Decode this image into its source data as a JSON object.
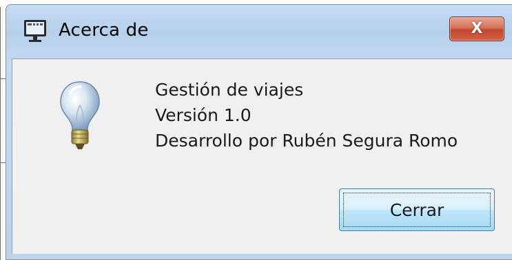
{
  "window": {
    "title": "Acerca de",
    "close_symbol": "X",
    "icon": "computer-monitor-icon"
  },
  "about": {
    "icon": "light-bulb-icon",
    "lines": [
      "Gestión de viajes",
      "Versión 1.0",
      "Desarrollo por Rubén Segura Romo"
    ]
  },
  "buttons": {
    "close_label": "Cerrar"
  },
  "colors": {
    "titlebar": "#b6d0ec",
    "content_bg": "#f0f0f0",
    "close_red": "#c4452a",
    "button_border": "#3c7fb1"
  }
}
